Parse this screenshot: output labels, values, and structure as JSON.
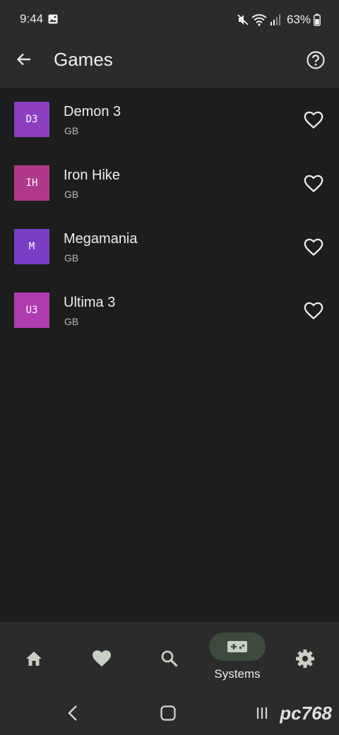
{
  "status_bar": {
    "time": "9:44",
    "battery": "63%"
  },
  "app_bar": {
    "title": "Games",
    "back_icon": "arrow-back-icon",
    "help_icon": "help-circle-icon"
  },
  "games": [
    {
      "initials": "D3",
      "name": "Demon 3",
      "system": "GB",
      "color": "#8e3ec2"
    },
    {
      "initials": "IH",
      "name": "Iron Hike",
      "system": "GB",
      "color": "#b2388c"
    },
    {
      "initials": "M",
      "name": "Megamania",
      "system": "GB",
      "color": "#7a3dc6"
    },
    {
      "initials": "U3",
      "name": "Ultima 3",
      "system": "GB",
      "color": "#b13cb0"
    }
  ],
  "bottom_nav": {
    "items": [
      {
        "icon": "home-icon",
        "label": ""
      },
      {
        "icon": "heart-icon",
        "label": ""
      },
      {
        "icon": "search-icon",
        "label": ""
      },
      {
        "icon": "gamepad-icon",
        "label": "Systems",
        "selected": true
      },
      {
        "icon": "gear-icon",
        "label": ""
      }
    ]
  },
  "colors": {
    "background": "#1c1d1c",
    "surface": "#2a2b2a",
    "selected_pill": "#3d4b3e",
    "icon": "#c8cfc4"
  },
  "watermark": "pc768"
}
